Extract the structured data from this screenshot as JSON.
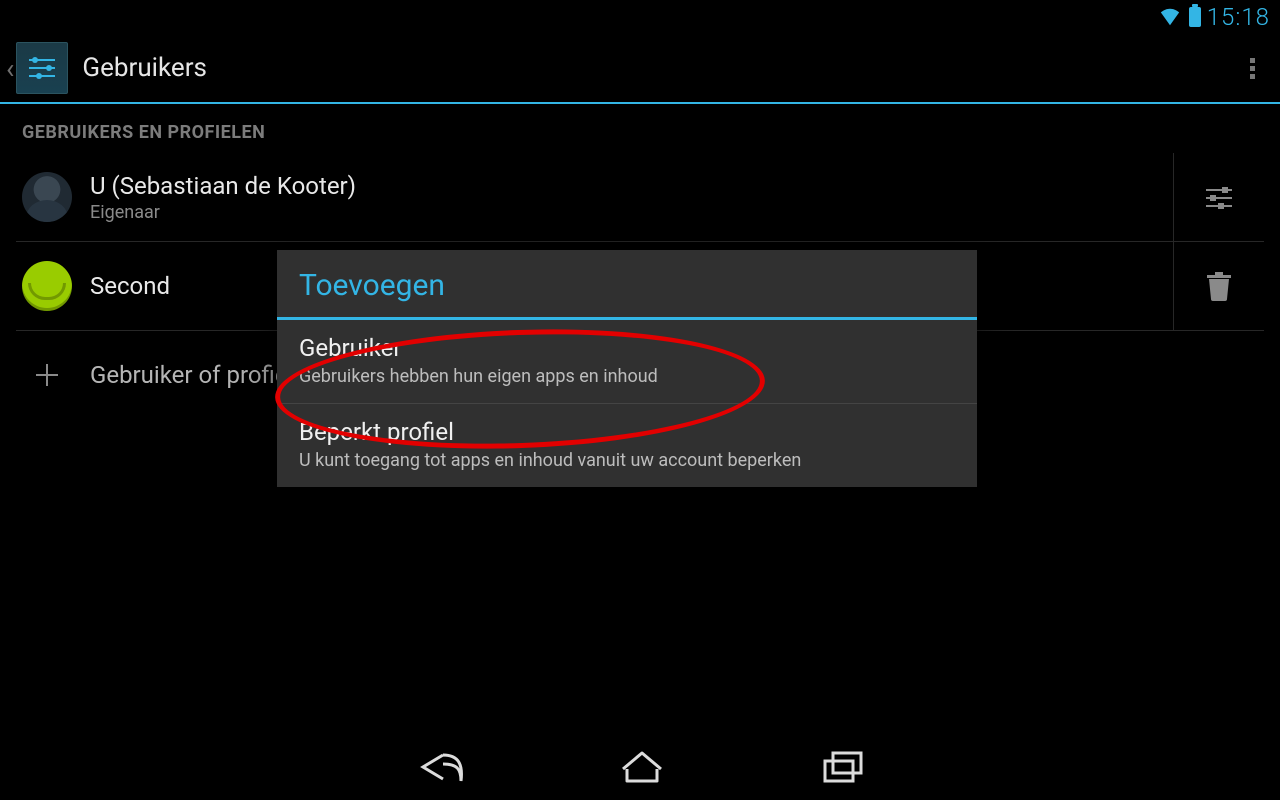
{
  "status": {
    "time": "15:18"
  },
  "header": {
    "title": "Gebruikers"
  },
  "section_title": "GEBRUIKERS EN PROFIELEN",
  "users": [
    {
      "name": "U (Sebastiaan de Kooter)",
      "role": "Eigenaar"
    },
    {
      "name": "Second"
    }
  ],
  "add_row_label": "Gebruiker of profiel toevoegen",
  "dialog": {
    "title": "Toevoegen",
    "options": [
      {
        "title": "Gebruiker",
        "subtitle": "Gebruikers hebben hun eigen apps en inhoud"
      },
      {
        "title": "Beperkt profiel",
        "subtitle": "U kunt toegang tot apps en inhoud vanuit uw account beperken"
      }
    ]
  }
}
